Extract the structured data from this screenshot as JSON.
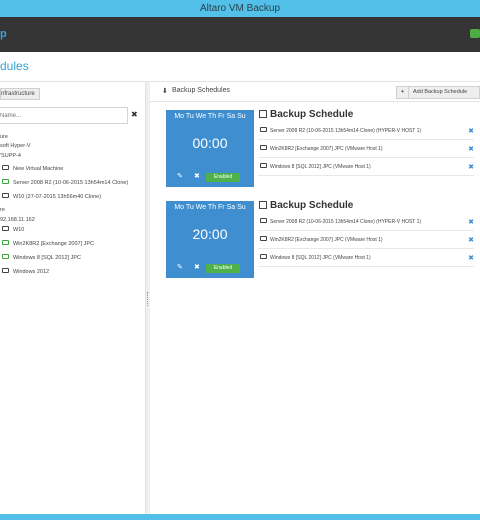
{
  "window": {
    "title": "Altaro VM Backup"
  },
  "app": {
    "brand_fragment": "p"
  },
  "page": {
    "title_fragment": "dules"
  },
  "left_panel": {
    "infra_button": "nfrastructure",
    "search_placeholder": "Name...",
    "search_clear": "✖",
    "tree": [
      {
        "label": "ure",
        "icon": "",
        "indent": 0
      },
      {
        "label": "soft Hyper-V",
        "icon": "",
        "indent": 0
      },
      {
        "label": "'SUPP-4",
        "icon": "",
        "indent": 0
      },
      {
        "label": "New Virtual Machine",
        "icon": "vm",
        "indent": 1
      },
      {
        "label": "Server 2008 R2 (10-06-2015 13h54m14 Clone)",
        "icon": "vm-green",
        "indent": 1
      },
      {
        "label": "W10 (27-07-2015 13h56m40 Clone)",
        "icon": "vm",
        "indent": 1
      },
      {
        "label": "re",
        "icon": "",
        "indent": 0
      },
      {
        "label": "92.168.11.162",
        "icon": "",
        "indent": 0
      },
      {
        "label": "W10",
        "icon": "vm",
        "indent": 1
      },
      {
        "label": "Win2K8R2 [Exchange 2007] JPC",
        "icon": "vm-green",
        "indent": 1
      },
      {
        "label": "Windows 8 [SQL 2012] JPC",
        "icon": "vm-green",
        "indent": 1
      },
      {
        "label": "Windows 2012",
        "icon": "vm",
        "indent": 1
      }
    ]
  },
  "right_panel": {
    "header_title": "Backup Schedules",
    "add_button": "Add Backup Schedule",
    "add_plus": "+",
    "schedules": [
      {
        "days": "Mo Tu We Th Fr Sa Su",
        "time": "00:00",
        "status": "Enabled",
        "title": "Backup Schedule",
        "vms": [
          "Server 2008 R2 (10-06-2015 13h54m14 Clone) (HYPER-V HOST 1)",
          "Win2K8R2 [Exchange 2007] JPC (VMware Host 1)",
          "Windows 8 [SQL 2012] JPC (VMware Host 1)"
        ]
      },
      {
        "days": "Mo Tu We Th Fr Sa Su",
        "time": "20:00",
        "status": "Enabled",
        "title": "Backup Schedule",
        "vms": [
          "Server 2008 R2 (10-06-2015 13h54m14 Clone) (HYPER-V HOST 1)",
          "Win2K8R2 [Exchange 2007] JPC (VMware Host 1)",
          "Windows 8 [SQL 2012] JPC (VMware Host 1)"
        ]
      }
    ]
  },
  "colors": {
    "accent": "#52c0e8",
    "tile": "#3e8ed0",
    "enabled": "#4fb14a",
    "appbar": "#353535"
  },
  "icons": {
    "edit": "pencil-icon",
    "delete": "close-icon",
    "calendar": "calendar-icon",
    "download": "download-icon"
  }
}
